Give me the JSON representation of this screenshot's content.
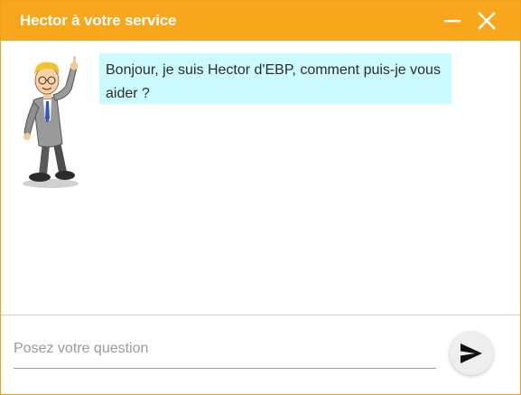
{
  "header": {
    "title": "Hector à votre service",
    "minimize_icon": "minimize-icon",
    "close_icon": "close-icon"
  },
  "colors": {
    "accent": "#f8a61c",
    "bubble": "#ccfbff"
  },
  "conversation": {
    "avatar": "hector-mascot",
    "messages": [
      {
        "from": "bot",
        "text": "Bonjour, je suis Hector d'EBP, comment puis-je vous aider ?"
      }
    ]
  },
  "composer": {
    "placeholder": "Posez votre question",
    "value": "",
    "send_icon": "send-icon"
  }
}
